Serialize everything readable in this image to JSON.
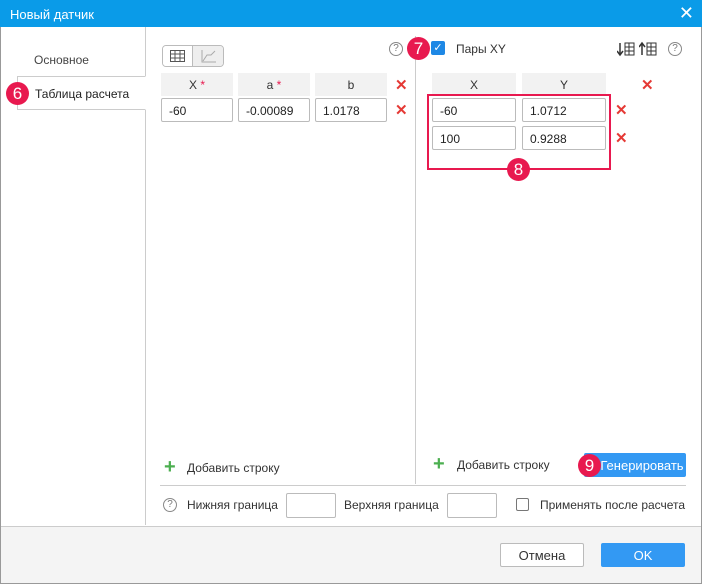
{
  "window": {
    "title": "Новый датчик"
  },
  "tabs": [
    {
      "label": "Основное"
    },
    {
      "label": "Таблица расчета"
    }
  ],
  "left_table": {
    "headers": [
      "X",
      "a",
      "b"
    ],
    "required_marks": [
      "*",
      "*"
    ],
    "rows": [
      [
        "-60",
        "-0.00089",
        "1.0178"
      ]
    ],
    "add_row": "Добавить строку"
  },
  "right_table": {
    "xy_pairs_label": "Пары XY",
    "xy_pairs_checked": true,
    "headers": [
      "X",
      "Y"
    ],
    "rows": [
      [
        "-60",
        "1.0712"
      ],
      [
        "100",
        "0.9288"
      ]
    ],
    "add_row": "Добавить строку",
    "generate": "Генерировать"
  },
  "bounds": {
    "lower_label": "Нижняя граница",
    "lower_value": "",
    "upper_label": "Верхняя граница",
    "upper_value": "",
    "apply_after_label": "Применять после расчета",
    "apply_after_checked": false
  },
  "footer": {
    "cancel": "Отмена",
    "ok": "OK"
  },
  "badges": [
    "6",
    "7",
    "8",
    "9"
  ],
  "help": "?",
  "close": "✕",
  "delete": "✕",
  "plus": "+",
  "colors": {
    "accent": "#0a9be8",
    "button": "#3399f3",
    "badge": "#e8194f",
    "delete": "#e53935"
  }
}
